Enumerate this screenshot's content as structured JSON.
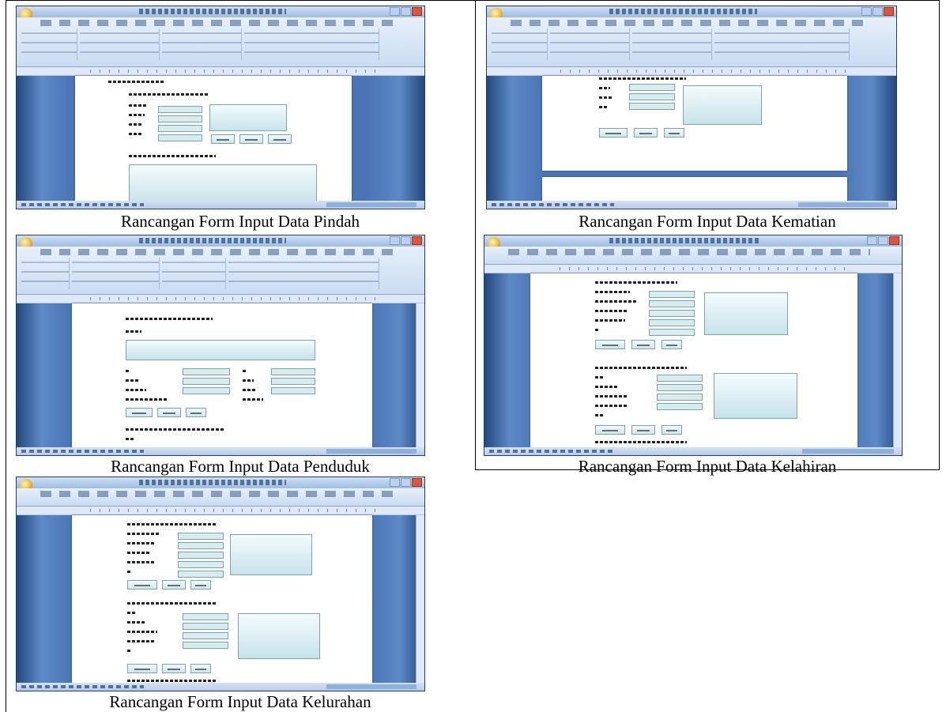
{
  "figures": [
    {
      "id": "pindah",
      "caption": "Rancangan Form Input Data Pindah"
    },
    {
      "id": "kematian",
      "caption": "Rancangan Form Input Data Kematian"
    },
    {
      "id": "penduduk",
      "caption": "Rancangan Form Input Data Penduduk"
    },
    {
      "id": "kelahiran",
      "caption": "Rancangan Form Input Data Kelahiran"
    },
    {
      "id": "kelurahan",
      "caption": "Rancangan Form Input Data Kelurahan"
    }
  ],
  "icons": {
    "office_orb": "office-button-icon",
    "window_close": "close-icon",
    "window_minimize": "minimize-icon",
    "window_maximize": "maximize-icon"
  },
  "colors": {
    "window_frame": "#2b4f86",
    "ribbon": "#dbe7f6",
    "form_field": "#d8ecf0",
    "form_border": "#7aa5b0"
  }
}
